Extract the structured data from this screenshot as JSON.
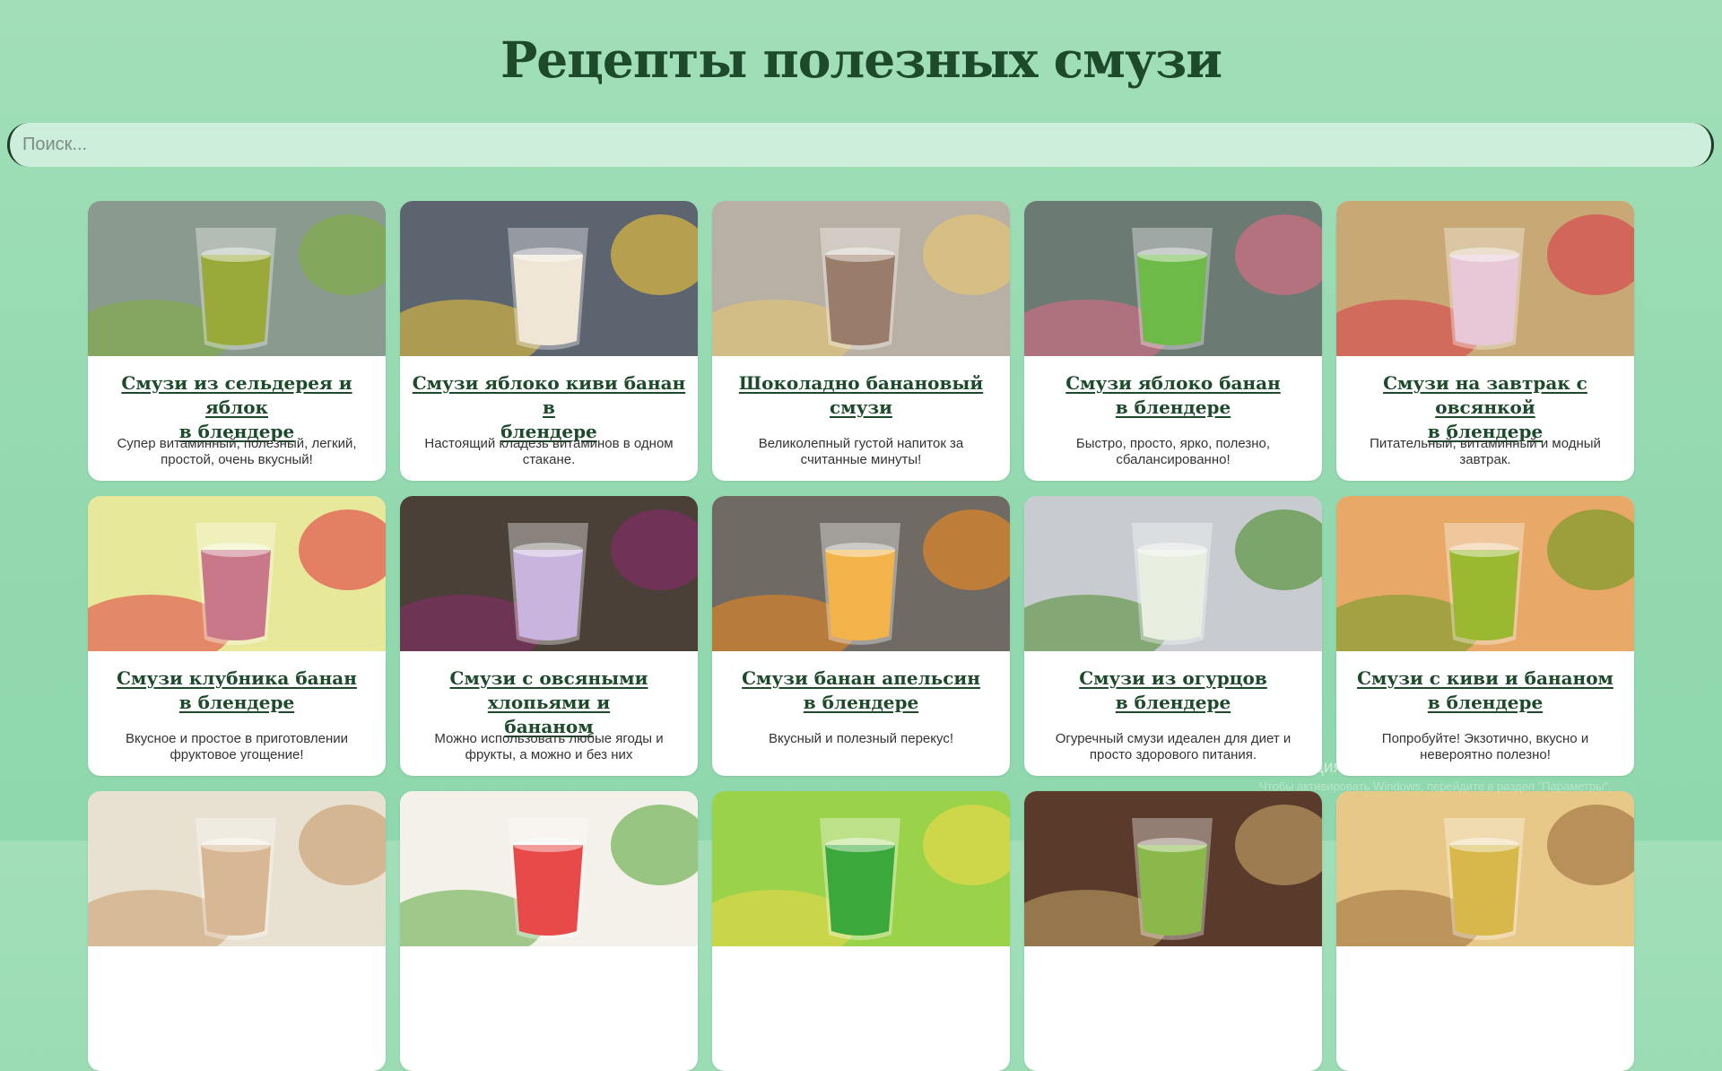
{
  "page": {
    "title": "Рецепты полезных смузи"
  },
  "search": {
    "placeholder": "Поиск..."
  },
  "cards": [
    {
      "title": "Смузи из сельдерея и яблок\nв блендере",
      "desc": "Супер витаминный, полезный, легкий, простой, очень вкусный!",
      "bg": "#8a9a8e",
      "accent": "#9aaa3a",
      "fruit": "#7fb03a"
    },
    {
      "title": "Смузи яблоко киви банан в\nблендере",
      "desc": "Настоящий кладезь витаминов в одном стакане.",
      "bg": "#5c6470",
      "accent": "#efe6d6",
      "fruit": "#f2c83a"
    },
    {
      "title": "Шоколадно банановый\nсмузи",
      "desc": "Великолепный густой напиток за считанные минуты!",
      "bg": "#b8b0a4",
      "accent": "#9a7c6a",
      "fruit": "#e9c870"
    },
    {
      "title": "Смузи яблоко банан\nв блендере",
      "desc": "Быстро, просто, ярко, полезно, сбалансированно!",
      "bg": "#6c7a74",
      "accent": "#6dba48",
      "fruit": "#e46b85"
    },
    {
      "title": "Смузи на завтрак с овсянкой\nв блендере",
      "desc": "Питательный, витаминный и модный завтрак.",
      "bg": "#c8a874",
      "accent": "#e8c8d6",
      "fruit": "#d83a4a"
    },
    {
      "title": "Смузи клубника банан\nв блендере",
      "desc": "Вкусное и простое в приготовлении фруктовое угощение!",
      "bg": "#e8e89a",
      "accent": "#c87888",
      "fruit": "#e03a40"
    },
    {
      "title": "Смузи с овсяными хлопьями и\nбананом",
      "desc": "Можно использовать любые ягоды и фрукты, а можно и без них",
      "bg": "#4a4038",
      "accent": "#c8b4dc",
      "fruit": "#8a2a6a"
    },
    {
      "title": "Смузи банан апельсин\nв блендере",
      "desc": "Вкусный и полезный перекус!",
      "bg": "#706a64",
      "accent": "#f2b44a",
      "fruit": "#f28a1a"
    },
    {
      "title": "Смузи из огурцов\nв блендере",
      "desc": "Огуречный смузи идеален для диет и просто здорового питания.",
      "bg": "#c8ccd0",
      "accent": "#e8eee0",
      "fruit": "#4a8a2a"
    },
    {
      "title": "Смузи с киви и бананом\nв блендере",
      "desc": "Попробуйте! Экзотично, вкусно и невероятно полезно!",
      "bg": "#e8a868",
      "accent": "#9ab830",
      "fruit": "#6a9a20"
    },
    {
      "title": "",
      "desc": "",
      "bg": "#e8e0d0",
      "accent": "#d8b894",
      "fruit": "#c89a6a"
    },
    {
      "title": "",
      "desc": "",
      "bg": "#f4f0ea",
      "accent": "#e84a4a",
      "fruit": "#5aa83a"
    },
    {
      "title": "",
      "desc": "",
      "bg": "#9ad24a",
      "accent": "#3aa83a",
      "fruit": "#f2d84a"
    },
    {
      "title": "",
      "desc": "",
      "bg": "#5a3a2a",
      "accent": "#8ab84a",
      "fruit": "#c8a86a"
    },
    {
      "title": "",
      "desc": "",
      "bg": "#e8c888",
      "accent": "#d8b84a",
      "fruit": "#9a6a3a"
    }
  ],
  "watermark": {
    "title": "Активация Windows",
    "subtitle": "Чтобы активировать Windows, перейдите в раздел \"Параметры\"."
  },
  "colors": {
    "title": "#1e4a2c",
    "background": "#9bdcb5",
    "search_bg": "#cdeedb",
    "card_bg": "#ffffff"
  }
}
